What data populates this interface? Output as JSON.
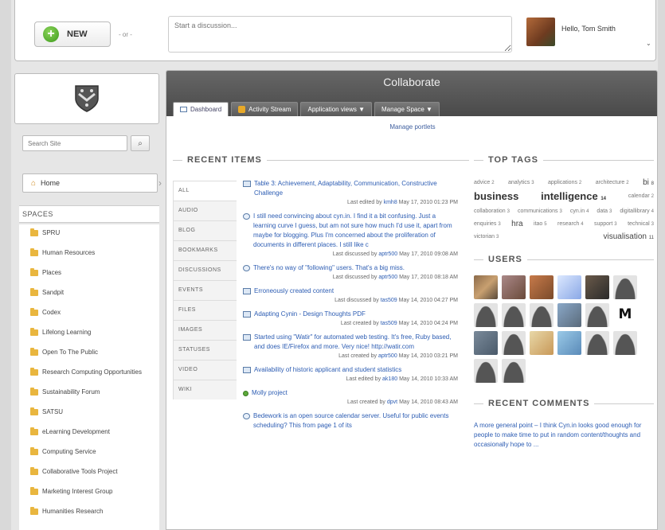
{
  "header": {
    "new_label": "NEW",
    "or_label": "- or -",
    "discussion_placeholder": "Start a discussion...",
    "greeting": "Hello, Tom Smith",
    "caret": "⌄"
  },
  "sidebar": {
    "search_placeholder": "Search Site",
    "home_label": "Home",
    "spaces_heading": "SPACES",
    "spaces": [
      "SPRU",
      "Human Resources",
      "Places",
      "Sandpit",
      "Codex",
      "Lifelong Learning",
      "Open To The Public",
      "Research Computing Opportunities",
      "Sustainability Forum",
      "SATSU",
      "eLearning Development",
      "Computing Service",
      "Collaborative Tools Project",
      "Marketing Interest Group",
      "Humanities Research"
    ]
  },
  "main": {
    "title": "Collaborate",
    "tabs": [
      "Dashboard",
      "Activity Stream",
      "Application views ▼",
      "Manage Space ▼"
    ],
    "manage_portlets": "Manage portlets",
    "recent_heading": "RECENT ITEMS",
    "filters": [
      "ALL",
      "AUDIO",
      "BLOG",
      "BOOKMARKS",
      "DISCUSSIONS",
      "EVENTS",
      "FILES",
      "IMAGES",
      "STATUSES",
      "VIDEO",
      "WIKI"
    ],
    "items": [
      {
        "icon": "doc",
        "title": "Table 3: Achievement, Adaptability, Communication, Constructive Challenge",
        "meta_pre": "Last edited by",
        "who": "kmh8",
        "meta_post": "May 17, 2010 01:23 PM"
      },
      {
        "icon": "msg",
        "title": "I still need convincing about cyn.in. I find it a bit confusing. Just a learning curve I guess, but am not sure how much I'd use it, apart from maybe for blogging. Plus I'm concerned about the proliferation of documents in different places. I still like c",
        "meta_pre": "Last discussed by",
        "who": "aptr500",
        "meta_post": "May 17, 2010 09:08 AM"
      },
      {
        "icon": "msg",
        "title": "There's no way of \"following\" users. That's a big miss.",
        "meta_pre": "Last discussed by",
        "who": "aptr500",
        "meta_post": "May 17, 2010 08:18 AM"
      },
      {
        "icon": "doc",
        "title": "Erroneously created content",
        "meta_pre": "Last discussed by",
        "who": "tas509",
        "meta_post": "May 14, 2010 04:27 PM"
      },
      {
        "icon": "doc",
        "title": "Adapting Cynin - Design Thoughts PDF",
        "meta_pre": "Last created by",
        "who": "tas509",
        "meta_post": "May 14, 2010 04:24 PM"
      },
      {
        "icon": "doc",
        "title": "Started using \"Watir\" for automated web testing. It's free, Ruby based, and does IE/Firefox and more. Very nice! http://watir.com",
        "meta_pre": "Last created by",
        "who": "aptr500",
        "meta_post": "May 14, 2010 03:21 PM"
      },
      {
        "icon": "doc",
        "title": "Availability of historic applicant and student statistics",
        "meta_pre": "Last edited by",
        "who": "ak180",
        "meta_post": "May 14, 2010 10:33 AM"
      },
      {
        "icon": "green",
        "title": "Molly project",
        "meta_pre": "Last created by",
        "who": "dpvt",
        "meta_post": "May 14, 2010 08:43 AM"
      },
      {
        "icon": "msg",
        "title": "Bedework is an open source calendar server. Useful for public events scheduling? This from page 1 of its",
        "meta_pre": "",
        "who": "",
        "meta_post": ""
      }
    ],
    "tags_heading": "TOP TAGS",
    "tags": [
      {
        "t": "advice",
        "n": "2",
        "s": ""
      },
      {
        "t": "analytics",
        "n": "3",
        "s": ""
      },
      {
        "t": "applications",
        "n": "2",
        "s": ""
      },
      {
        "t": "architecture",
        "n": "2",
        "s": ""
      },
      {
        "t": "bi",
        "n": "8",
        "s": "mid"
      },
      {
        "t": "business",
        "n": "",
        "s": "big"
      },
      {
        "t": "intelligence",
        "n": "14",
        "s": "big"
      },
      {
        "t": "calendar",
        "n": "2",
        "s": ""
      },
      {
        "t": "collaboration",
        "n": "3",
        "s": ""
      },
      {
        "t": "communications",
        "n": "3",
        "s": ""
      },
      {
        "t": "cyn.in",
        "n": "4",
        "s": ""
      },
      {
        "t": "data",
        "n": "3",
        "s": ""
      },
      {
        "t": "digitallibrary",
        "n": "4",
        "s": ""
      },
      {
        "t": "enquiries",
        "n": "3",
        "s": ""
      },
      {
        "t": "hra",
        "n": "",
        "s": "mid"
      },
      {
        "t": "itao",
        "n": "5",
        "s": ""
      },
      {
        "t": "research",
        "n": "4",
        "s": ""
      },
      {
        "t": "support",
        "n": "3",
        "s": ""
      },
      {
        "t": "technical",
        "n": "3",
        "s": ""
      },
      {
        "t": "victorian",
        "n": "3",
        "s": ""
      },
      {
        "t": "visualisation",
        "n": "11",
        "s": "mid"
      }
    ],
    "users_heading": "USERS",
    "users": [
      "p1",
      "p2",
      "p3",
      "p4",
      "p5",
      "g",
      "g",
      "g",
      "g",
      "p6",
      "g",
      "p7",
      "p8",
      "g",
      "p9",
      "p10",
      "g",
      "g",
      "g",
      "g"
    ],
    "comments_heading": "RECENT COMMENTS",
    "comment": "A more general point – I think Cyn.in looks good enough for people to make time to put in random content/thoughts and occasionally hope to ..."
  }
}
